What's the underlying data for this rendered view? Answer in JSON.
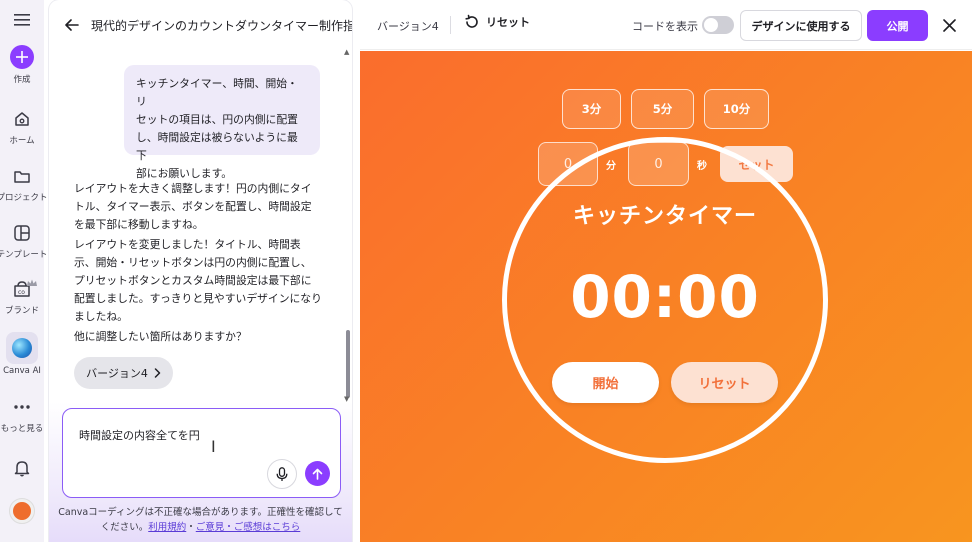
{
  "rail": {
    "create_label": "作成",
    "home_label": "ホーム",
    "project_label": "プロジェクト",
    "template_label": "テンプレート",
    "brand_label": "ブランド",
    "ai_label": "Canva AI",
    "more_label": "もっと見る"
  },
  "chat": {
    "title": "現代的デザインのカウントダウンタイマー制作指示",
    "user_message_lines": [
      "キッチンタイマー、時間、開始・リ",
      "セットの項目は、円の内側に配置",
      "し、時間設定は被らないように最下",
      "部にお願いします。"
    ],
    "ai_message_1_lines": [
      "レイアウトを大きく調整します！円の内側にタイ",
      "トル、タイマー表示、ボタンを配置し、時間設定",
      "を最下部に移動しますね。"
    ],
    "ai_message_2_lines": [
      "レイアウトを変更しました！タイトル、時間表",
      "示、開始・リセットボタンは円の内側に配置し、",
      "プリセットボタンとカスタム時間設定は最下部に",
      "配置しました。すっきりと見やすいデザインになり",
      "ましたね。"
    ],
    "ai_message_3": "他に調整したい箇所はありますか？",
    "version_chip": "バージョン4",
    "input_value": "時間設定の内容全てを円",
    "disclaimer_line1": "Canvaコーディングは不正確な場合があります。正確性を確認して",
    "disclaimer_prefix": "ください。",
    "terms_link": "利用規約",
    "bullet": "・",
    "feedback_link": "ご意見・ご感想はこちら"
  },
  "toolbar": {
    "version_label": "バージョン4",
    "reset_label": "リセット",
    "show_code_label": "コードを表示",
    "show_code_on": false,
    "use_in_design_label": "デザインに使用する",
    "publish_label": "公開"
  },
  "timer": {
    "presets": [
      "3分",
      "5分",
      "10分"
    ],
    "minutes_value": "0",
    "minutes_unit": "分",
    "seconds_value": "0",
    "seconds_unit": "秒",
    "set_label": "セット",
    "title": "キッチンタイマー",
    "display": "00:00",
    "start_label": "開始",
    "reset_label": "リセット"
  },
  "colors": {
    "accent": "#8b3dff",
    "canvas_gradient_start": "#fa6d2d",
    "canvas_gradient_end": "#f8951f",
    "button_text": "#f2703a"
  },
  "icons": [
    "menu-icon",
    "plus-icon",
    "home-icon",
    "folder-icon",
    "template-icon",
    "brand-icon",
    "crown-icon",
    "canva-ai-icon",
    "more-icon",
    "bell-icon",
    "back-arrow-icon",
    "chevron-right-icon",
    "microphone-icon",
    "send-arrow-icon",
    "reset-icon",
    "close-icon"
  ]
}
